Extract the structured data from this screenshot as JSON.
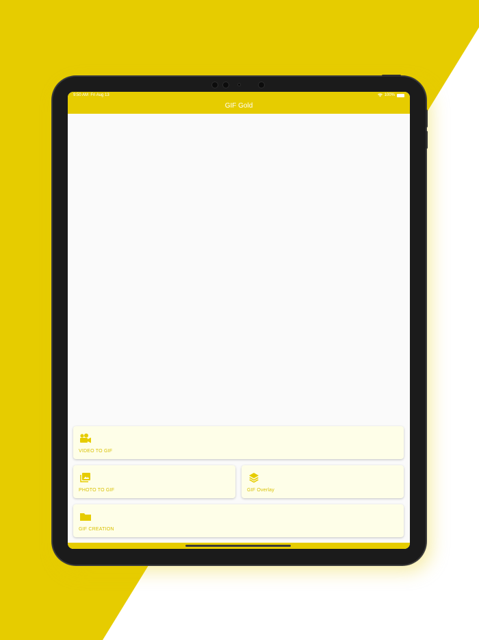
{
  "status_bar": {
    "time": "9:50 AM",
    "date": "Fri Aug 13",
    "battery": "100%"
  },
  "nav": {
    "title": "GIF Gold"
  },
  "cards": [
    {
      "label": "VIDEO TO GIF",
      "icon": "video-camera-icon"
    },
    {
      "label": "PHOTO TO GIF",
      "icon": "photo-library-icon"
    },
    {
      "label": "GIF Overlay",
      "icon": "layers-icon"
    },
    {
      "label": "GIF CREATION",
      "icon": "folder-icon"
    }
  ],
  "colors": {
    "accent": "#e6cc00",
    "card_bg": "#fefee8",
    "label": "#d8c000",
    "screen_bg": "#fafafa",
    "device": "#1b1b1b"
  }
}
